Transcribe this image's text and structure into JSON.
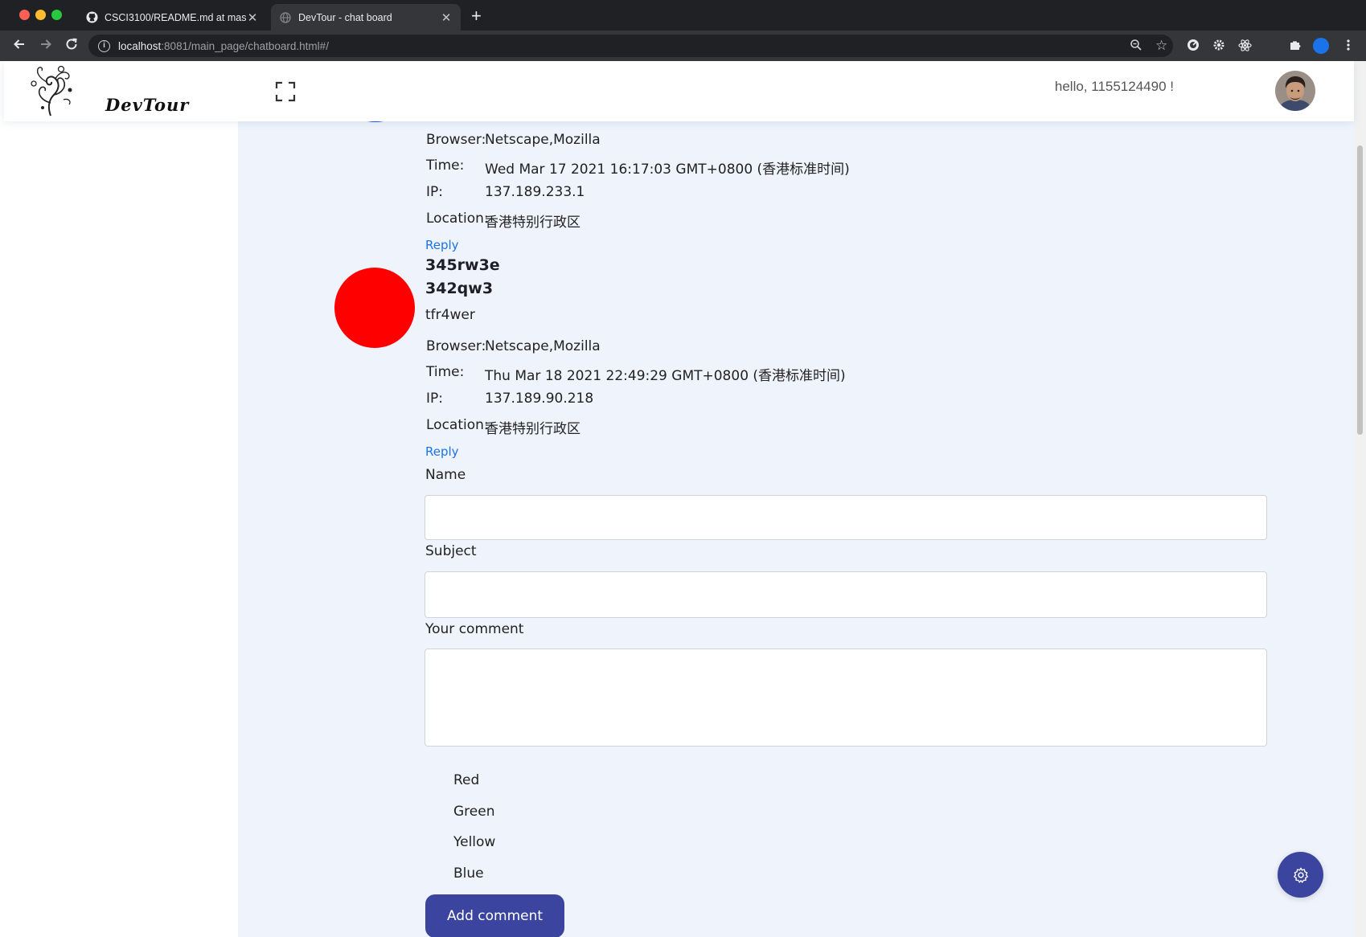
{
  "browser": {
    "tabs": [
      {
        "title": "CSCI3100/README.md at mas",
        "active": false
      },
      {
        "title": "DevTour - chat board",
        "active": true
      }
    ],
    "new_tab": "+",
    "url_host": "localhost",
    "url_rest": ":8081/main_page/chatboard.html#/"
  },
  "header": {
    "logo_text": "DevTour",
    "greeting": "hello, 1155124490 !"
  },
  "comments": [
    {
      "avatar_color": "#1f4cff",
      "browser_label": "Browser:",
      "browser": "Netscape,Mozilla",
      "time_label": "Time:",
      "time": "Wed Mar 17 2021 16:17:03 GMT+0800 (香港标准时间)",
      "ip_label": "IP:",
      "ip": "137.189.233.1",
      "location_label": "Location:",
      "location": "香港特别行政区",
      "reply": "Reply"
    },
    {
      "avatar_color": "#ff0000",
      "name": "345rw3e",
      "subject": "342qw3",
      "body": "tfr4wer",
      "browser_label": "Browser:",
      "browser": "Netscape,Mozilla",
      "time_label": "Time:",
      "time": "Thu Mar 18 2021 22:49:29 GMT+0800 (香港标准时间)",
      "ip_label": "IP:",
      "ip": "137.189.90.218",
      "location_label": "Location:",
      "location": "香港特别行政区",
      "reply": "Reply"
    }
  ],
  "form": {
    "name_label": "Name",
    "name_value": "",
    "subject_label": "Subject",
    "subject_value": "",
    "comment_label": "Your comment",
    "comment_value": "",
    "colors": [
      "Red",
      "Green",
      "Yellow",
      "Blue"
    ],
    "submit": "Add comment"
  },
  "colors": {
    "accent": "#3b45a0",
    "link": "#1a73e8",
    "page_bg": "#eef3fc"
  }
}
